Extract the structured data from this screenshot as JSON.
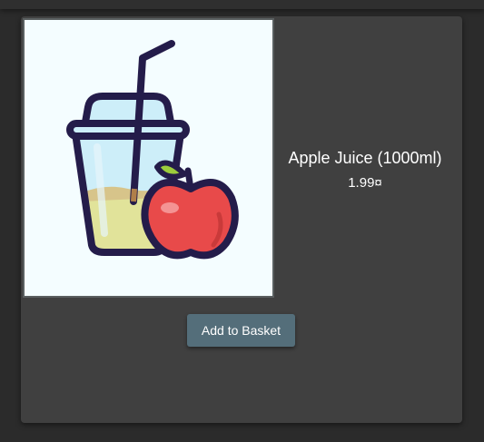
{
  "product": {
    "name": "Apple Juice (1000ml)",
    "price": "1.99¤",
    "image_icon": "apple-juice-cup-icon"
  },
  "actions": {
    "add_to_basket_label": "Add to Basket"
  },
  "colors": {
    "background": "#2b2b2b",
    "card": "#404040",
    "button": "#546e7a",
    "text": "#ffffff"
  }
}
